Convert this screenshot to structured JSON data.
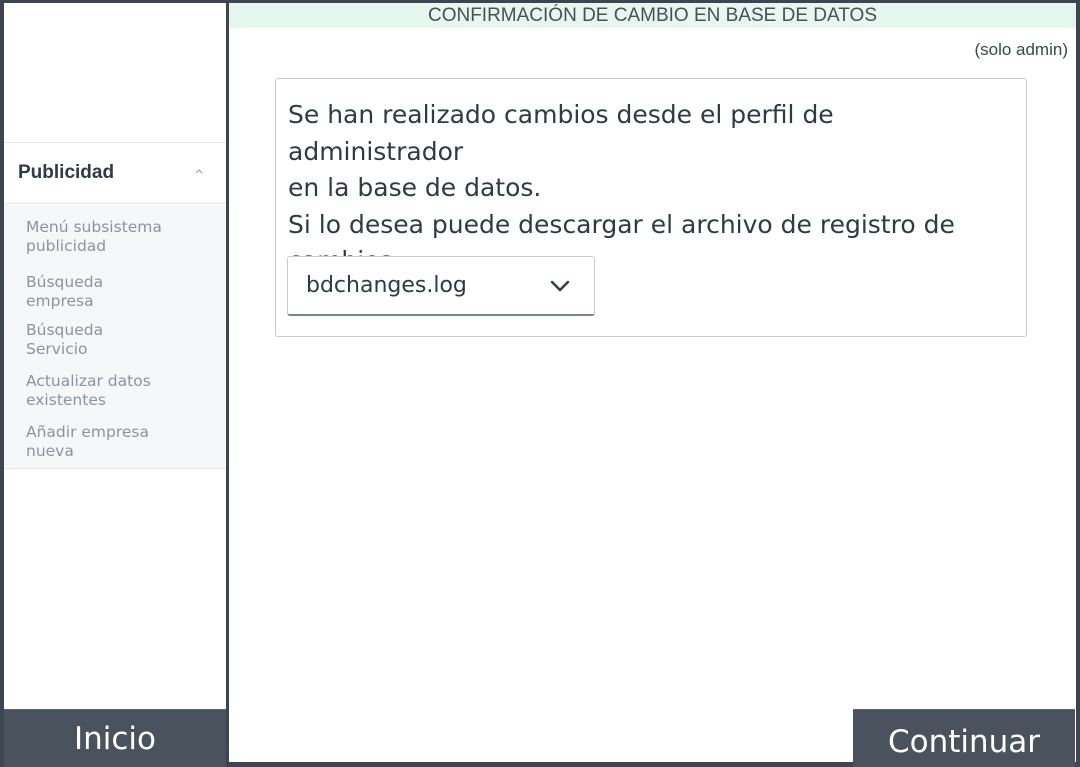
{
  "header": {
    "title": "CONFIRMACIÓN DE CAMBIO EN BASE DE DATOS",
    "admin_note": "(solo admin)"
  },
  "sidebar": {
    "section_title": "Publicidad",
    "chevron_icon": "chevron-up-icon",
    "items": [
      {
        "label": "Menú subsistema\npublicidad"
      },
      {
        "label": "Búsqueda\nempresa"
      },
      {
        "label": "Búsqueda\nServicio"
      },
      {
        "label": "Actualizar datos\nexistentes"
      },
      {
        "label": "Añadir empresa\nnueva"
      }
    ]
  },
  "main": {
    "message_lines": [
      "Se han realizado cambios desde el perfil de administrador",
      "en la base de datos.",
      "Si lo desea puede descargar el archivo de registro de",
      "cambios"
    ],
    "file_select": {
      "value": "bdchanges.log",
      "icon": "chevron-down-icon"
    }
  },
  "footer": {
    "home_label": "Inicio",
    "continue_label": "Continuar"
  },
  "colors": {
    "frame": "#3d4650",
    "button_bg": "#4a535d",
    "title_bar_bg": "#e6f7ef",
    "submenu_bg": "#f6f7f9"
  }
}
